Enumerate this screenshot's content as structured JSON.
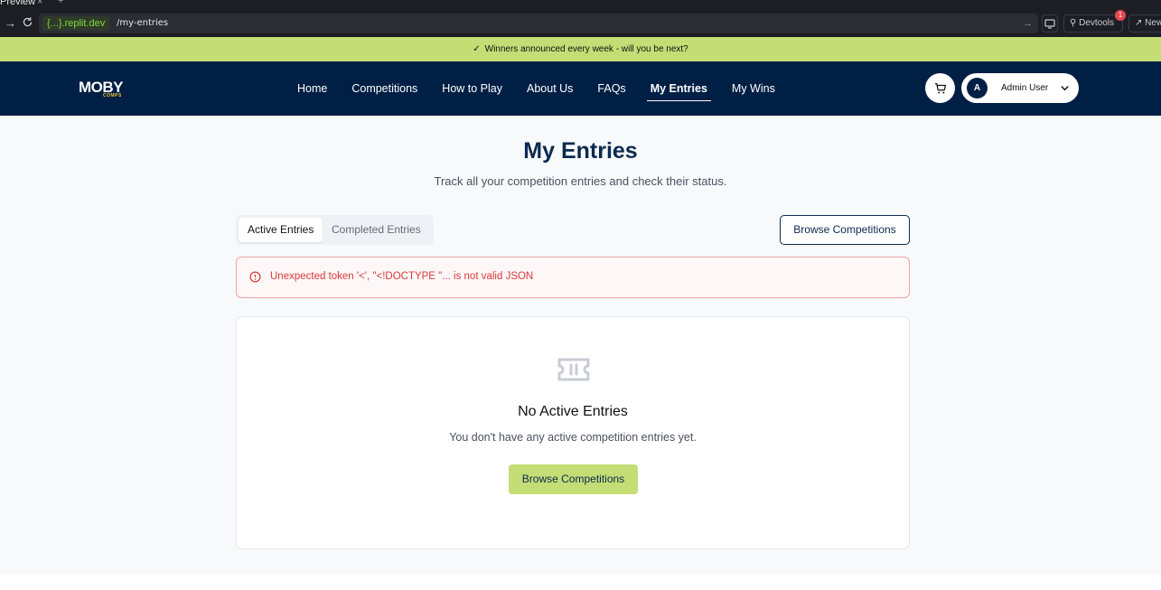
{
  "browser": {
    "tab_title": "Preview",
    "tab_close": "×",
    "tab_new": "+",
    "url_host": "{...}.replit.dev",
    "url_path": "/my-entries",
    "devtools_label": "Devtools",
    "devtools_badge": "1",
    "new_tab_label": "New"
  },
  "announcement": {
    "check": "✓",
    "text": "Winners announced every week - will you be next?"
  },
  "navbar": {
    "logo": "MOBY",
    "logo_sub": "COMPS",
    "links": [
      {
        "label": "Home"
      },
      {
        "label": "Competitions"
      },
      {
        "label": "How to Play"
      },
      {
        "label": "About Us"
      },
      {
        "label": "FAQs"
      },
      {
        "label": "My Entries",
        "active": true
      },
      {
        "label": "My Wins"
      }
    ],
    "user": {
      "initial": "A",
      "name": "Admin User"
    }
  },
  "page": {
    "title": "My Entries",
    "subtitle": "Track all your competition entries and check their status.",
    "tabs": [
      {
        "label": "Active Entries",
        "active": true
      },
      {
        "label": "Completed Entries",
        "active": false
      }
    ],
    "browse_button": "Browse Competitions",
    "error": "Unexpected token '<', \"<!DOCTYPE \"... is not valid JSON",
    "empty": {
      "title": "No Active Entries",
      "description": "You don't have any active competition entries yet.",
      "button": "Browse Competitions"
    }
  },
  "colors": {
    "navy": "#001f45",
    "lime": "#c4dd75",
    "error": "#d93b3b"
  }
}
